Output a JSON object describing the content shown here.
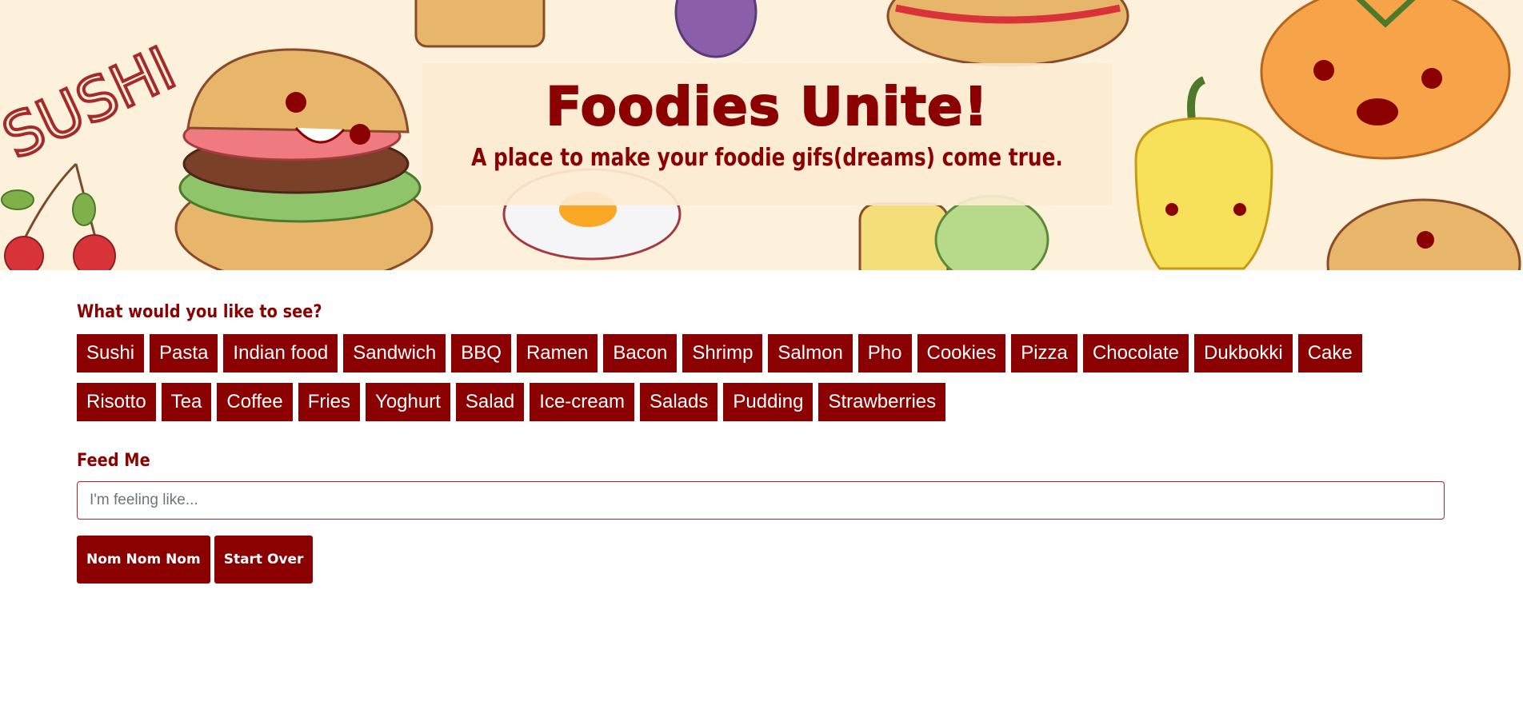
{
  "header": {
    "title": "Foodies Unite!",
    "subtitle": "A place to make your foodie gifs(dreams) come true.",
    "banner_text": "SUSHI"
  },
  "topics_section": {
    "label": "What would you like to see?",
    "topics": [
      "Sushi",
      "Pasta",
      "Indian food",
      "Sandwich",
      "BBQ",
      "Ramen",
      "Bacon",
      "Shrimp",
      "Salmon",
      "Pho",
      "Cookies",
      "Pizza",
      "Chocolate",
      "Dukbokki",
      "Cake",
      "Risotto",
      "Tea",
      "Coffee",
      "Fries",
      "Yoghurt",
      "Salad",
      "Ice-cream",
      "Salads",
      "Pudding",
      "Strawberries"
    ]
  },
  "feed_section": {
    "label": "Feed Me",
    "input_placeholder": "I'm feeling like...",
    "input_value": ""
  },
  "actions": {
    "submit_label": "Nom Nom Nom",
    "reset_label": "Start Over"
  },
  "colors": {
    "accent": "#8b0000",
    "banner_bg": "#fdf1dc",
    "title_box_bg": "#fdecd2"
  },
  "banner_icons": [
    "sushi-sign-icon",
    "cherry-icon",
    "burger-icon",
    "fried-egg-icon",
    "hotdog-icon",
    "plum-icon",
    "corn-icon",
    "pepper-icon",
    "tomato-icon",
    "bun-icon"
  ]
}
